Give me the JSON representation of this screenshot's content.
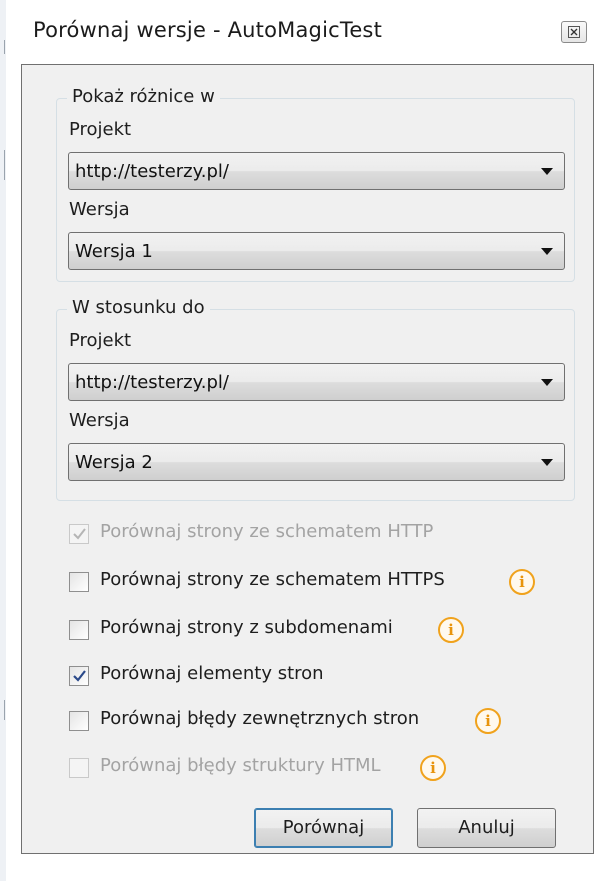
{
  "window": {
    "title": "Porównaj wersje - AutoMagicTest"
  },
  "source_group": {
    "title": "Pokaż różnice w",
    "project_label": "Projekt",
    "project_value": "http://testerzy.pl/",
    "version_label": "Wersja",
    "version_value": "Wersja 1"
  },
  "target_group": {
    "title": "W stosunku do",
    "project_label": "Projekt",
    "project_value": "http://testerzy.pl/",
    "version_label": "Wersja",
    "version_value": "Wersja 2"
  },
  "options": [
    {
      "label": "Porównaj strony ze schematem HTTP",
      "checked": true,
      "enabled": false,
      "info": false
    },
    {
      "label": "Porównaj strony ze schematem HTTPS",
      "checked": false,
      "enabled": true,
      "info": true
    },
    {
      "label": "Porównaj strony z subdomenami",
      "checked": false,
      "enabled": true,
      "info": true
    },
    {
      "label": "Porównaj elementy stron",
      "checked": true,
      "enabled": true,
      "info": false
    },
    {
      "label": "Porównaj błędy zewnętrznych stron",
      "checked": false,
      "enabled": true,
      "info": true
    },
    {
      "label": "Porównaj błędy struktury HTML",
      "checked": false,
      "enabled": false,
      "info": true
    }
  ],
  "info_icon_glyph": "i",
  "buttons": {
    "compare": "Porównaj",
    "cancel": "Anuluj"
  },
  "colors": {
    "info_accent": "#f0a21c",
    "check_mark": "#2b4a8a",
    "disabled_text": "#a3a3a3"
  }
}
